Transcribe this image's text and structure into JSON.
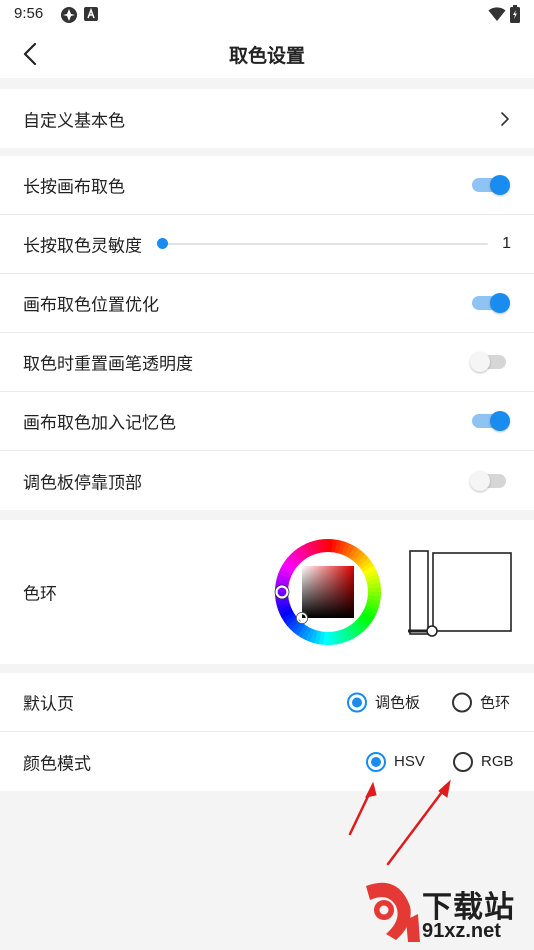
{
  "status_bar": {
    "time": "9:56"
  },
  "header": {
    "title": "取色设置"
  },
  "settings": {
    "custom_basic_color": {
      "label": "自定义基本色"
    },
    "long_press_canvas_pick": {
      "label": "长按画布取色",
      "enabled": true
    },
    "long_press_sensitivity": {
      "label": "长按取色灵敏度",
      "value": "1",
      "fraction": 0.0
    },
    "canvas_pick_position_opt": {
      "label": "画布取色位置优化",
      "enabled": true
    },
    "reset_brush_opacity": {
      "label": "取色时重置画笔透明度",
      "enabled": false
    },
    "add_to_memory_color": {
      "label": "画布取色加入记忆色",
      "enabled": true
    },
    "palette_dock_top": {
      "label": "调色板停靠顶部",
      "enabled": false
    }
  },
  "color_wheel": {
    "label": "色环",
    "selected_color": "#d90000"
  },
  "default_page": {
    "label": "默认页",
    "options": [
      {
        "label": "调色板",
        "selected": true
      },
      {
        "label": "色环",
        "selected": false
      }
    ]
  },
  "color_mode": {
    "label": "颜色模式",
    "options": [
      {
        "label": "HSV",
        "selected": true
      },
      {
        "label": "RGB",
        "selected": false
      }
    ]
  },
  "watermark": {
    "brand": "下载站",
    "url": "91xz.net"
  },
  "colors": {
    "accent": "#1a8cf0",
    "annotation_arrow": "#e01b1b",
    "watermark_logo": "#e53935"
  }
}
